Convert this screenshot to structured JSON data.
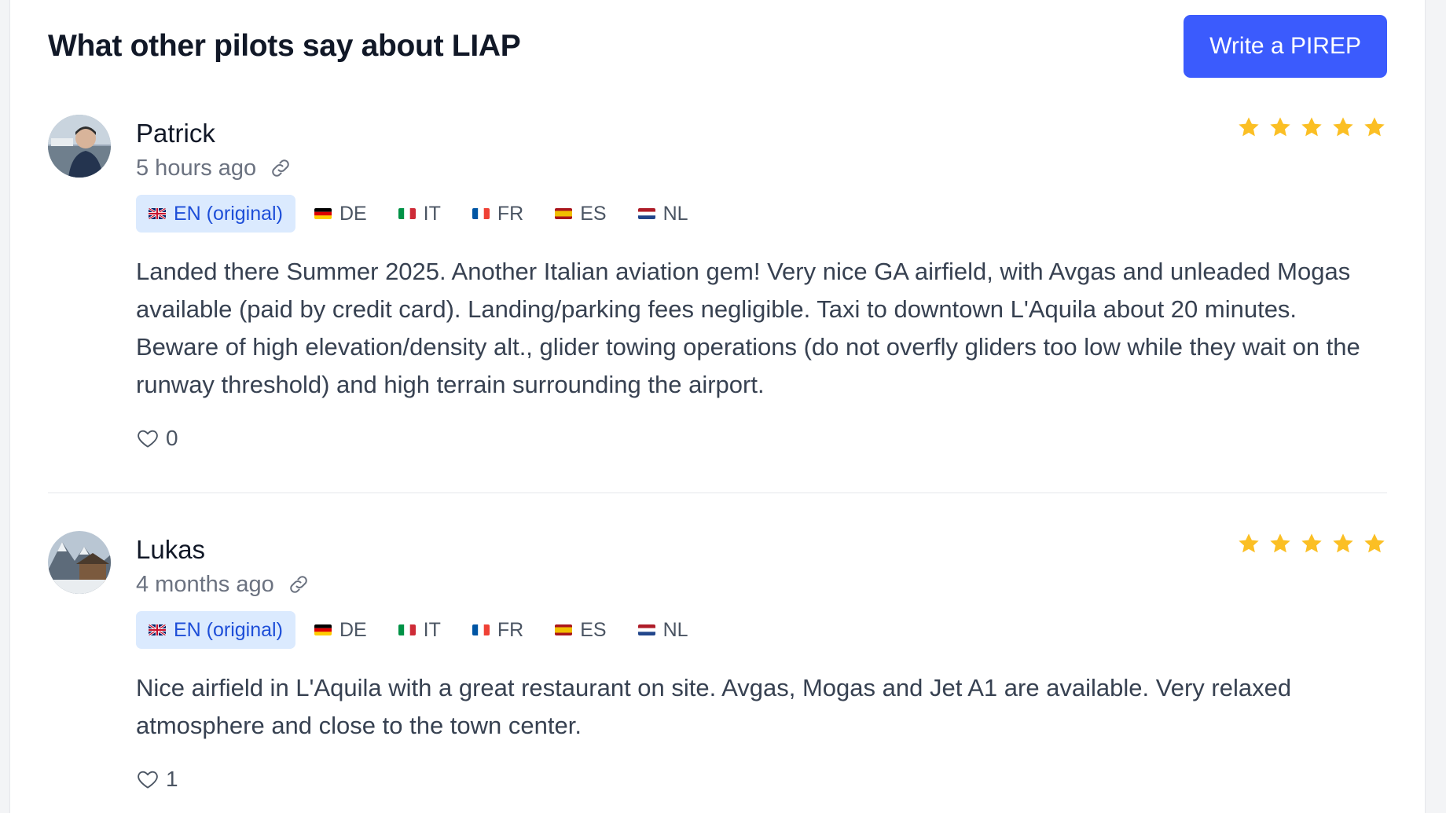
{
  "page": {
    "title": "What other pilots say about LIAP",
    "write_button": "Write a PIREP"
  },
  "colors": {
    "accent": "#3b5bfd",
    "star": "#fbbf24",
    "lang_active_bg": "#dbeafe",
    "lang_active_text": "#1d4ed8"
  },
  "reviews": [
    {
      "author": "Patrick",
      "time": "5 hours ago",
      "rating": 5,
      "languages": [
        "EN (original)",
        "DE",
        "IT",
        "FR",
        "ES",
        "NL"
      ],
      "active_language": "EN (original)",
      "text": "Landed there Summer 2025. Another Italian aviation gem! Very nice GA airfield, with Avgas and unleaded Mogas available (paid by credit card). Landing/parking fees negligible. Taxi to downtown L'Aquila about 20 minutes. Beware of high elevation/density alt., glider towing operations (do not overfly gliders too low while they wait on the runway threshold) and high terrain surrounding the airport.",
      "likes": "0"
    },
    {
      "author": "Lukas",
      "time": "4 months ago",
      "rating": 5,
      "languages": [
        "EN (original)",
        "DE",
        "IT",
        "FR",
        "ES",
        "NL"
      ],
      "active_language": "EN (original)",
      "text": "Nice airfield in L'Aquila with a great restaurant on site. Avgas, Mogas and Jet A1 are available. Very relaxed atmosphere and close to the town center.",
      "likes": "1"
    }
  ]
}
